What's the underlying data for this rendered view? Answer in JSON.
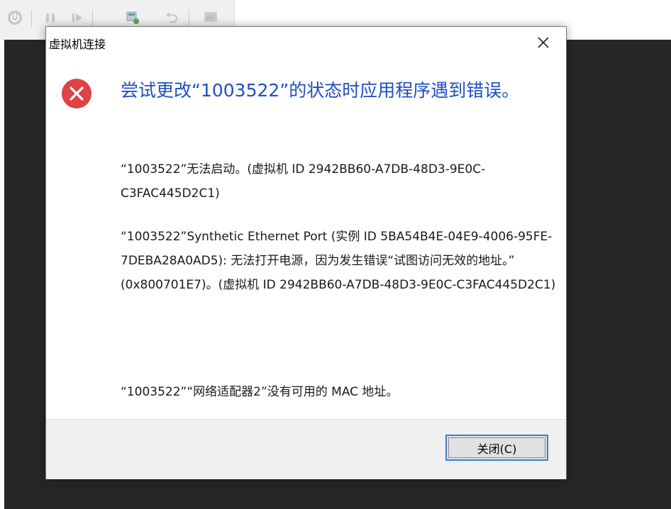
{
  "dialog": {
    "title": "虚拟机连接",
    "heading": "尝试更改“1003522”的状态时应用程序遇到错误。",
    "messages": [
      "“1003522”无法启动。(虚拟机 ID 2942BB60-A7DB-48D3-9E0C-C3FAC445D2C1)",
      "“1003522”Synthetic Ethernet Port (实例 ID 5BA54B4E-04E9-4006-95FE-7DEBA28A0AD5): 无法打开电源，因为发生错误“试图访问无效的地址。” (0x800701E7)。(虚拟机 ID 2942BB60-A7DB-48D3-9E0C-C3FAC445D2C1)",
      "“1003522”“网络适配器2”没有可用的 MAC 地址。"
    ],
    "close_button_label": "关闭(C)",
    "close_icon": "close-x-icon",
    "error_icon": "error-circle-icon"
  },
  "toolbar": {
    "icons": [
      "power-icon",
      "pause-icon",
      "play-step-icon",
      "checkpoint-icon",
      "revert-icon",
      "enhanced-session-icon"
    ]
  },
  "colors": {
    "heading": "#1f4fbf",
    "error_red": "#e04343",
    "vm_background": "#262626",
    "button_border": "#3c7fd6",
    "footer_bg": "#f0f0f0"
  }
}
